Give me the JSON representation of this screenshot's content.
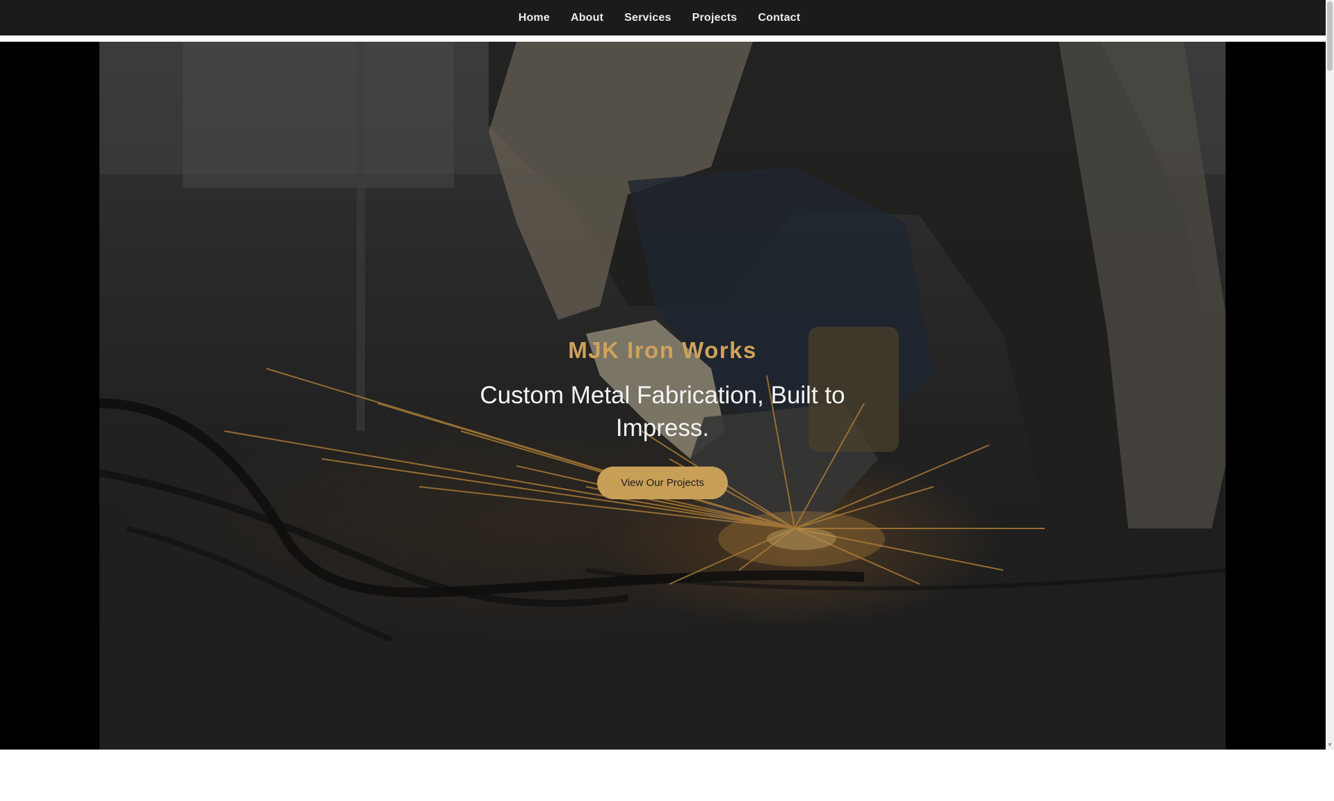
{
  "nav": {
    "items": [
      {
        "label": "Home"
      },
      {
        "label": "About"
      },
      {
        "label": "Services"
      },
      {
        "label": "Projects"
      },
      {
        "label": "Contact"
      }
    ]
  },
  "hero": {
    "brand": "MJK Iron Works",
    "tagline": "Custom Metal Fabrication, Built to Impress.",
    "cta_label": "View Our Projects",
    "image_icon": "welding-sparks-photo"
  },
  "colors": {
    "nav_bg": "#1b1b1b",
    "brand_gold": "#cfa25d",
    "cta_bg": "#c89f57",
    "hero_frame": "#000000"
  }
}
